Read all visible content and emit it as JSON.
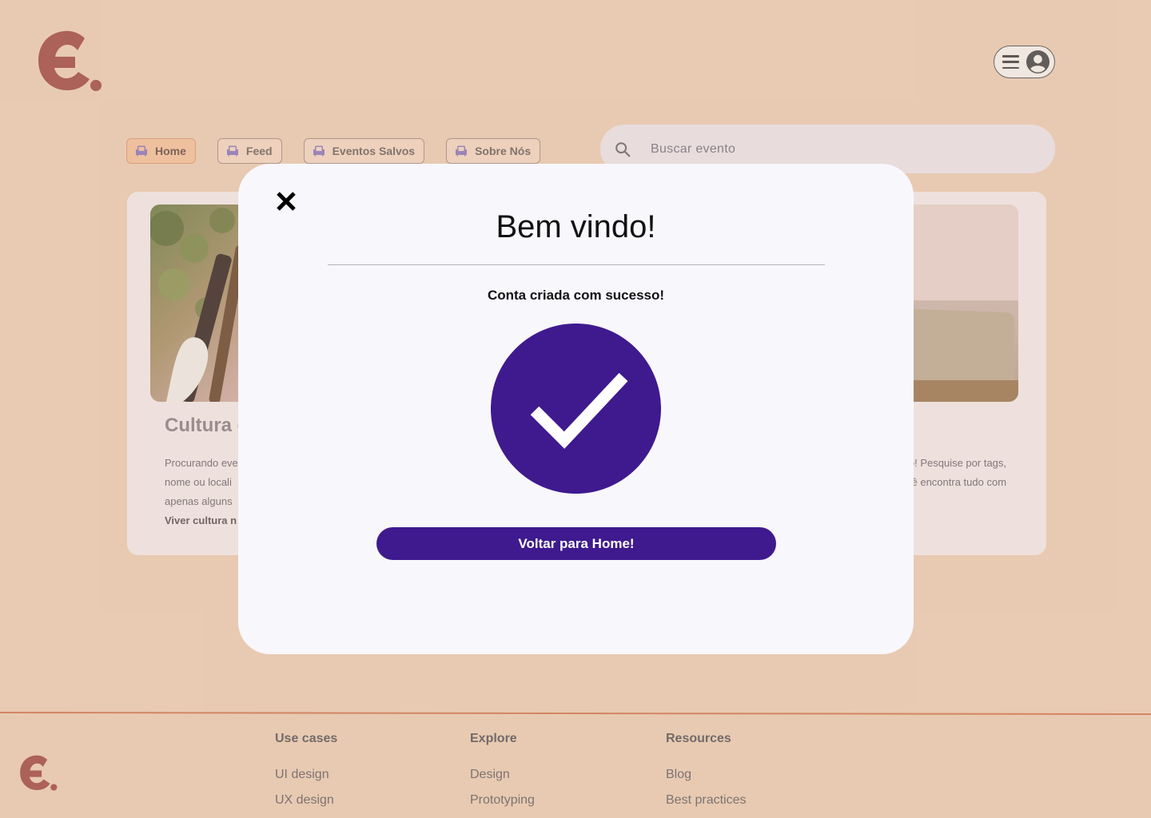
{
  "colors": {
    "background": "#e8cbb2",
    "brand": "#a24f49",
    "accent": "#3e1a8e",
    "modal": "#f8f7fc"
  },
  "header": {
    "logo_icon": "brand-e-logo",
    "menu_icon": "hamburger-icon",
    "account_icon": "user-avatar-icon"
  },
  "nav": {
    "items": [
      {
        "label": "Home",
        "icon": "sofa-icon",
        "active": true
      },
      {
        "label": "Feed",
        "icon": "sofa-icon",
        "active": false
      },
      {
        "label": "Eventos Salvos",
        "icon": "sofa-icon",
        "active": false
      },
      {
        "label": "Sobre Nós",
        "icon": "sofa-icon",
        "active": false
      }
    ]
  },
  "search": {
    "placeholder": "Buscar evento",
    "icon": "search-icon"
  },
  "card": {
    "title": "Cultura e",
    "text_left": [
      "Procurando eve",
      "nome ou locali",
      "apenas alguns"
    ],
    "text_left_bold": "Viver cultura n",
    "text_right": [
      "lo! Pesquise por tags,",
      "cê encontra tudo com"
    ]
  },
  "modal": {
    "title": "Bem vindo!",
    "subtitle": "Conta criada com sucesso!",
    "button_label": "Voltar para Home!",
    "close_icon": "close-icon",
    "status_icon": "checkmark-icon"
  },
  "footer": {
    "columns": [
      {
        "heading": "Use cases",
        "links": [
          "UI design",
          "UX design"
        ]
      },
      {
        "heading": "Explore",
        "links": [
          "Design",
          "Prototyping"
        ]
      },
      {
        "heading": "Resources",
        "links": [
          "Blog",
          "Best practices"
        ]
      }
    ]
  }
}
